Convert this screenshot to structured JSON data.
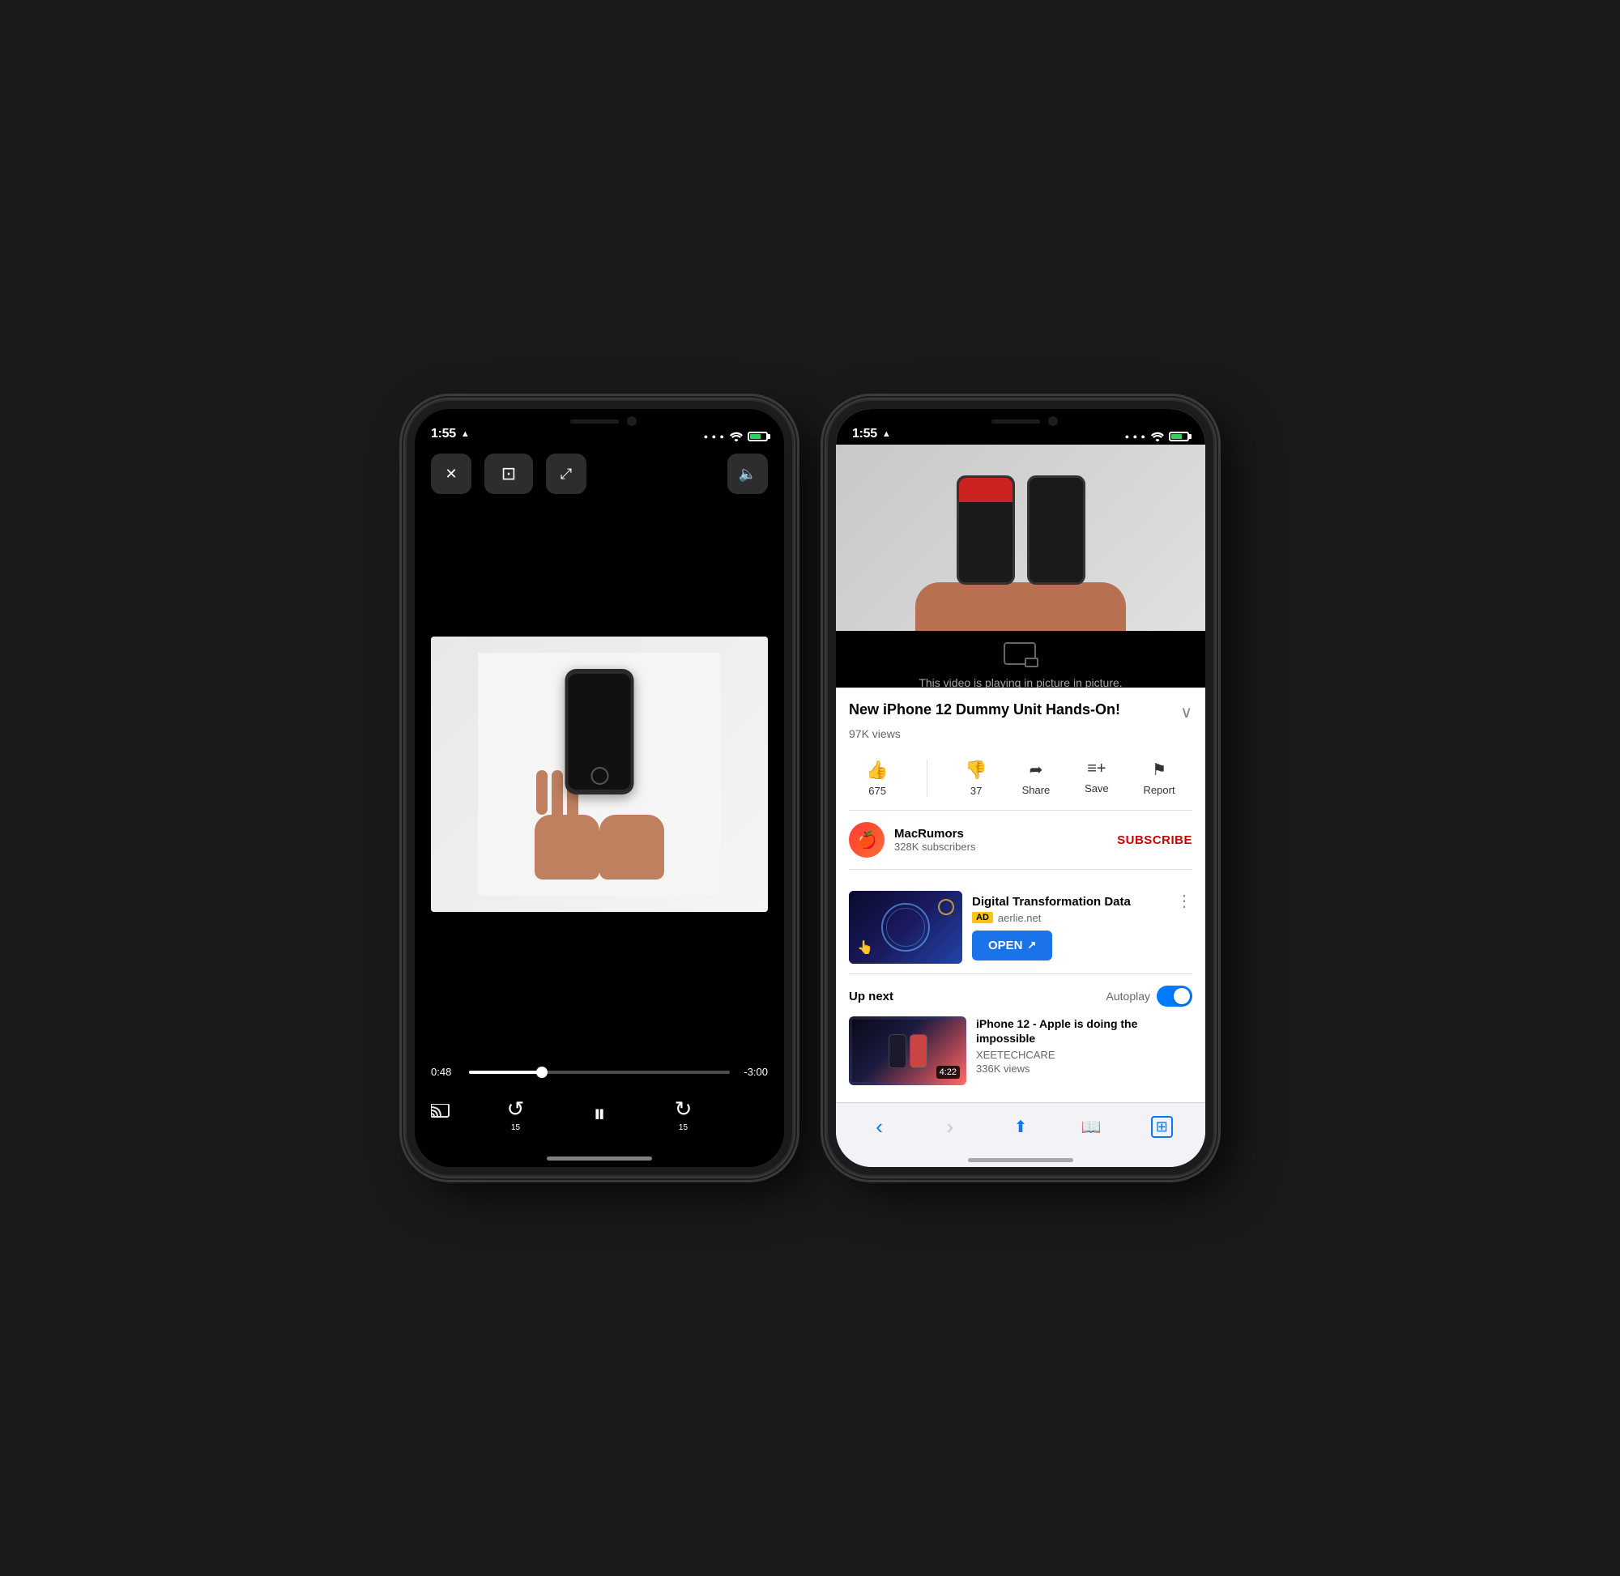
{
  "left_phone": {
    "status_bar": {
      "time": "1:55",
      "has_location": true
    },
    "controls": {
      "close_label": "✕",
      "pip_label": "⊡",
      "expand_label": "⤢",
      "volume_label": "🔈"
    },
    "progress": {
      "current_time": "0:48",
      "remaining_time": "-3:00",
      "percent": 28
    },
    "playback": {
      "skip_back_seconds": "15",
      "skip_fwd_seconds": "15",
      "is_paused": false
    }
  },
  "right_phone": {
    "status_bar": {
      "time": "1:55",
      "has_location": true
    },
    "pip_message": "This video is playing in picture in picture.",
    "video": {
      "title": "New iPhone 12 Dummy Unit Hands-On!",
      "views": "97K views",
      "likes": "675",
      "dislikes": "37",
      "share_label": "Share",
      "save_label": "Save",
      "report_label": "Report"
    },
    "channel": {
      "name": "MacRumors",
      "subscribers": "328K subscribers",
      "subscribe_label": "SUBSCRIBE"
    },
    "ad": {
      "title": "Digital Transformation Data",
      "badge": "AD",
      "url": "aerlie.net",
      "open_label": "OPEN"
    },
    "up_next": {
      "label": "Up next",
      "autoplay_label": "Autoplay",
      "autoplay_on": true,
      "next_video": {
        "title": "iPhone 12 - Apple is doing the impossible",
        "channel": "XEETECHCARE",
        "views": "336K views",
        "duration": "4:22"
      }
    },
    "browser": {
      "back_label": "‹",
      "forward_label": "›",
      "share_label": "⬆",
      "bookmarks_label": "📖",
      "tabs_label": "⊞"
    }
  }
}
